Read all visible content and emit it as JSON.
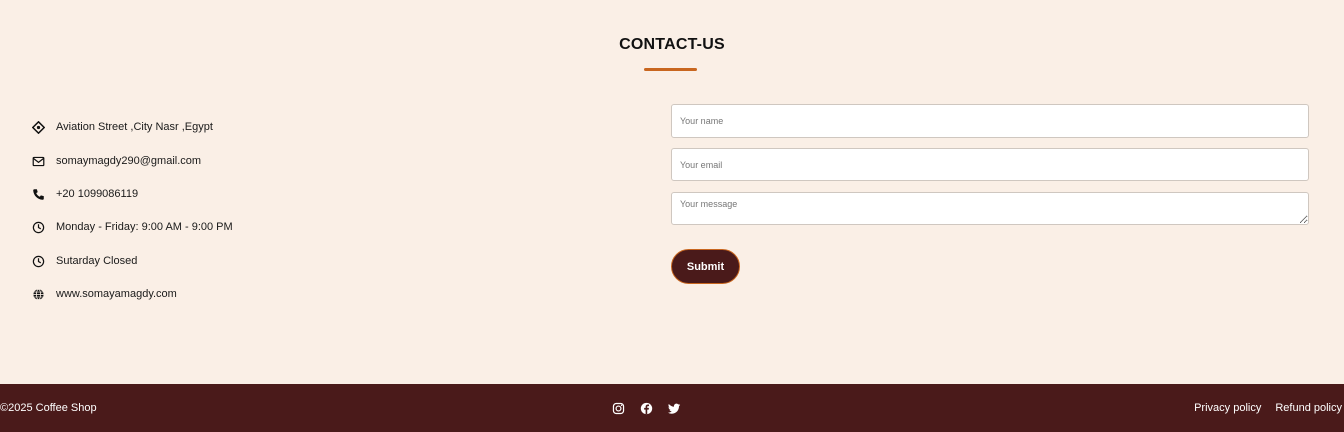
{
  "contact": {
    "title": "CONTACT-US",
    "info": [
      {
        "icon": "location-icon",
        "text": "Aviation Street ,City Nasr ,Egypt"
      },
      {
        "icon": "envelope-icon",
        "text": "somaymagdy290@gmail.com"
      },
      {
        "icon": "phone-icon",
        "text": "+20 1099086119"
      },
      {
        "icon": "clock-icon",
        "text": "Monday - Friday: 9:00 AM - 9:00 PM"
      },
      {
        "icon": "clock-icon",
        "text": "Sutarday Closed"
      },
      {
        "icon": "globe-icon",
        "text": "www.somayamagdy.com"
      }
    ]
  },
  "form": {
    "name_placeholder": "Your name",
    "email_placeholder": "Your email",
    "message_placeholder": "Your message",
    "submit_label": "Submit"
  },
  "footer": {
    "copyright": "©2025 Coffee Shop",
    "socials": [
      "instagram-icon",
      "facebook-icon",
      "twitter-icon"
    ],
    "links": [
      "Privacy policy",
      "Refund policy"
    ]
  },
  "colors": {
    "background": "#faefe6",
    "accent": "#c8661f",
    "brand_dark": "#4a1a1a"
  }
}
